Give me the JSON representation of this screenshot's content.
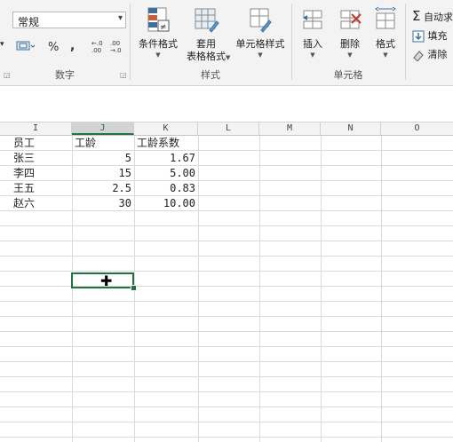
{
  "ribbon": {
    "number_format": {
      "value": "常规",
      "arrow": "▾"
    },
    "number_group": {
      "label": "数字",
      "currency_icon": "currency-icon",
      "percent": "%",
      "comma": ",",
      "increase_decimal": "←.0\n.00",
      "decrease_decimal": ".00\n→.0"
    },
    "styles_group": {
      "label": "样式",
      "conditional_format": "条件格式",
      "table_format_line1": "套用",
      "table_format_line2": "表格格式",
      "cell_styles": "单元格样式"
    },
    "cells_group": {
      "label": "单元格",
      "insert": "插入",
      "delete": "删除",
      "format": "格式"
    },
    "editing": {
      "autosum": "自动求",
      "fill": "填充",
      "clear": "清除"
    }
  },
  "sheet": {
    "columns": [
      "I",
      "J",
      "K",
      "L",
      "M",
      "N",
      "O"
    ],
    "selected_column": "J",
    "header_row": [
      "员工",
      "工龄",
      "工龄系数"
    ],
    "rows": [
      [
        "张三",
        "5",
        "1.67"
      ],
      [
        "李四",
        "15",
        "5.00"
      ],
      [
        "王五",
        "2.5",
        "0.83"
      ],
      [
        "赵六",
        "30",
        "10.00"
      ]
    ]
  }
}
